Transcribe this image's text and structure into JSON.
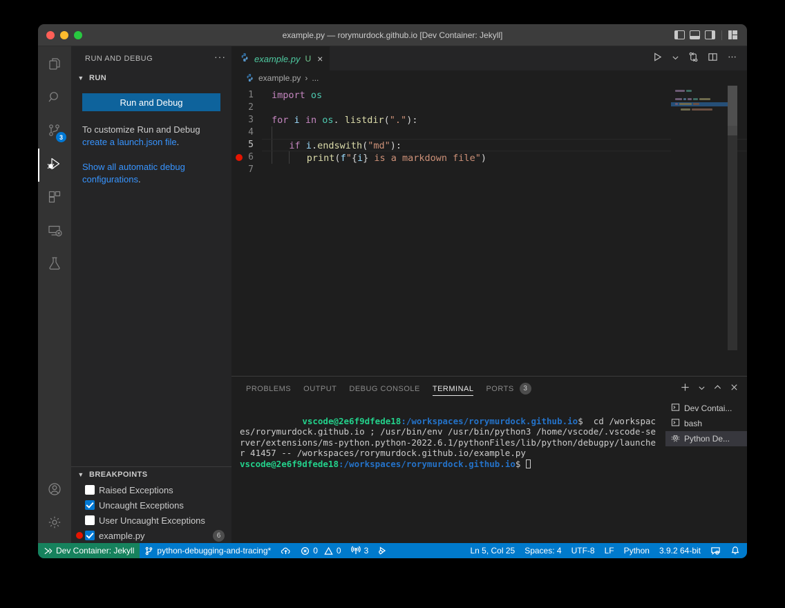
{
  "window": {
    "title": "example.py — rorymurdock.github.io [Dev Container: Jekyll]"
  },
  "activitybar": {
    "items": [
      {
        "name": "explorer",
        "icon": "files-icon",
        "badge": ""
      },
      {
        "name": "search",
        "icon": "search-icon",
        "badge": ""
      },
      {
        "name": "source-control",
        "icon": "source-control-icon",
        "badge": "3"
      },
      {
        "name": "run-and-debug",
        "icon": "run-debug-icon",
        "badge": ""
      },
      {
        "name": "extensions",
        "icon": "extensions-icon",
        "badge": ""
      },
      {
        "name": "remote-explorer",
        "icon": "remote-explorer-icon",
        "badge": ""
      },
      {
        "name": "testing",
        "icon": "beaker-icon",
        "badge": ""
      }
    ],
    "bottom": [
      {
        "name": "accounts",
        "icon": "account-icon"
      },
      {
        "name": "settings",
        "icon": "gear-icon"
      }
    ]
  },
  "sidebar": {
    "title": "RUN AND DEBUG",
    "more_actions": "···",
    "run_section": {
      "header": "RUN",
      "run_button": "Run and Debug",
      "customize_text": "To customize Run and Debug ",
      "customize_link": "create a launch.json file",
      "customize_period": ".",
      "show_all_link": "Show all automatic debug configurations",
      "show_all_period": "."
    },
    "breakpoints": {
      "header": "BREAKPOINTS",
      "rows": [
        {
          "label": "Raised Exceptions",
          "checked": false,
          "has_dot": false,
          "count": ""
        },
        {
          "label": "Uncaught Exceptions",
          "checked": true,
          "has_dot": false,
          "count": ""
        },
        {
          "label": "User Uncaught Exceptions",
          "checked": false,
          "has_dot": false,
          "count": ""
        },
        {
          "label": "example.py",
          "checked": true,
          "has_dot": true,
          "count": "6"
        }
      ]
    }
  },
  "editor": {
    "tab": {
      "filename": "example.py",
      "modified_badge": "U",
      "close": "×"
    },
    "breadcrumb": {
      "file": "example.py",
      "separator": "›",
      "more": "..."
    },
    "toolbar": [
      {
        "name": "run-python-file-button",
        "icon": "play-icon"
      },
      {
        "name": "run-options-chevron",
        "icon": "chevron-down-icon"
      },
      {
        "name": "source-control-compare-button",
        "icon": "compare-icon"
      },
      {
        "name": "split-editor-right-button",
        "icon": "split-editor-icon"
      },
      {
        "name": "more-editor-actions-button",
        "icon": "ellipsis-icon"
      }
    ],
    "lines": [
      {
        "no": "1",
        "breakpoint": false,
        "current": false,
        "indent": 0,
        "tokens": [
          {
            "t": "import",
            "c": "kw"
          },
          {
            "t": " ",
            "c": "pn"
          },
          {
            "t": "os",
            "c": "ty"
          }
        ]
      },
      {
        "no": "2",
        "breakpoint": false,
        "current": false,
        "indent": 0,
        "tokens": []
      },
      {
        "no": "3",
        "breakpoint": false,
        "current": false,
        "indent": 0,
        "tokens": [
          {
            "t": "for",
            "c": "kw"
          },
          {
            "t": " ",
            "c": "pn"
          },
          {
            "t": "i",
            "c": "id"
          },
          {
            "t": " ",
            "c": "pn"
          },
          {
            "t": "in",
            "c": "kw"
          },
          {
            "t": " ",
            "c": "pn"
          },
          {
            "t": "os",
            "c": "ty"
          },
          {
            "t": ". ",
            "c": "pn"
          },
          {
            "t": "listdir",
            "c": "fn"
          },
          {
            "t": "(",
            "c": "pn"
          },
          {
            "t": "\".\"",
            "c": "str"
          },
          {
            "t": "):",
            "c": "pn"
          }
        ]
      },
      {
        "no": "4",
        "breakpoint": false,
        "current": false,
        "indent": 1,
        "tokens": []
      },
      {
        "no": "5",
        "breakpoint": false,
        "current": true,
        "indent": 1,
        "tokens": [
          {
            "t": "if",
            "c": "kw"
          },
          {
            "t": " ",
            "c": "pn"
          },
          {
            "t": "i",
            "c": "id"
          },
          {
            "t": ".",
            "c": "pn"
          },
          {
            "t": "endswith",
            "c": "fn"
          },
          {
            "t": "(",
            "c": "pn"
          },
          {
            "t": "\"md\"",
            "c": "str"
          },
          {
            "t": "):",
            "c": "pn"
          }
        ]
      },
      {
        "no": "6",
        "breakpoint": true,
        "current": false,
        "indent": 2,
        "tokens": [
          {
            "t": "print",
            "c": "fn"
          },
          {
            "t": "(",
            "c": "pn"
          },
          {
            "t": "f",
            "c": "id"
          },
          {
            "t": "\"",
            "c": "str"
          },
          {
            "t": "{",
            "c": "pn"
          },
          {
            "t": "i",
            "c": "id"
          },
          {
            "t": "}",
            "c": "pn"
          },
          {
            "t": " is a markdown file\"",
            "c": "str"
          },
          {
            "t": ")",
            "c": "pn"
          }
        ]
      },
      {
        "no": "7",
        "breakpoint": false,
        "current": false,
        "indent": 0,
        "tokens": []
      }
    ]
  },
  "panel": {
    "tabs": [
      {
        "label": "PROBLEMS",
        "active": false,
        "count": ""
      },
      {
        "label": "OUTPUT",
        "active": false,
        "count": ""
      },
      {
        "label": "DEBUG CONSOLE",
        "active": false,
        "count": ""
      },
      {
        "label": "TERMINAL",
        "active": true,
        "count": ""
      },
      {
        "label": "PORTS",
        "active": false,
        "count": "3"
      }
    ],
    "actions": [
      {
        "name": "new-terminal-button",
        "icon": "plus-icon"
      },
      {
        "name": "terminal-profile-chevron",
        "icon": "chevron-down-icon"
      },
      {
        "name": "maximize-panel-button",
        "icon": "chevron-up-icon"
      },
      {
        "name": "close-panel-button",
        "icon": "close-icon"
      }
    ],
    "terminal": {
      "user_host_1": "vscode@2e6f9dfede18",
      "path_1": ":/workspaces/rorymurdock.github.io",
      "dollar_1": "$",
      "command": "  cd /workspaces/rorymurdock.github.io ; /usr/bin/env /usr/bin/python3 /home/vscode/.vscode-server/extensions/ms-python.python-2022.6.1/pythonFiles/lib/python/debugpy/launcher 41457 -- /workspaces/rorymurdock.github.io/example.py",
      "user_host_2": "vscode@2e6f9dfede18",
      "path_2": ":/workspaces/rorymurdock.github.io",
      "dollar_2": "$"
    },
    "terminal_tabs": [
      {
        "label": "Dev Contai...",
        "icon": "terminal-icon",
        "active": false
      },
      {
        "label": "bash",
        "icon": "terminal-icon",
        "active": false
      },
      {
        "label": "Python De...",
        "icon": "debug-icon",
        "active": true
      }
    ]
  },
  "statusbar": {
    "remote": "Dev Container: Jekyll",
    "branch": "python-debugging-and-tracing*",
    "errors": "0",
    "warnings": "0",
    "ports": "3",
    "position": "Ln 5, Col 25",
    "spaces": "Spaces: 4",
    "encoding": "UTF-8",
    "eol": "LF",
    "language": "Python",
    "interpreter": "3.9.2 64-bit"
  },
  "colors": {
    "accent": "#007acc",
    "remote_green": "#16825d",
    "button_blue": "#0e639c",
    "breakpoint_red": "#e51400",
    "link_blue": "#3794ff",
    "terminal_green": "#23d18b",
    "terminal_blue": "#2472c8"
  }
}
